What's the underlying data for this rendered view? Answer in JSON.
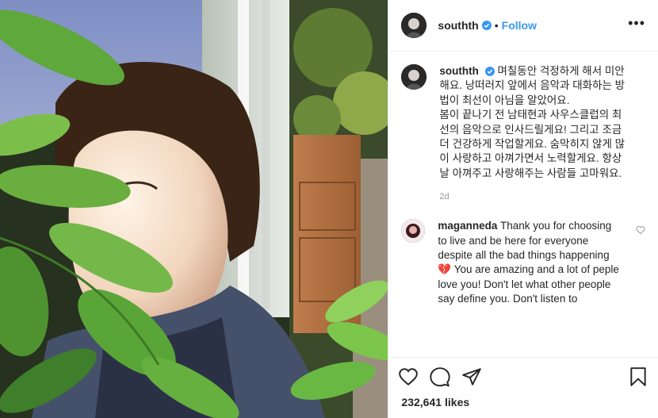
{
  "post": {
    "author": "southth",
    "follow_label": "Follow",
    "separator": "•",
    "caption_user": "southth",
    "caption": "며칠동안 걱정하게 해서 미안해요. 낭떠러지 앞에서 음악과 대화하는 방법이 최선이 아님을 알았어요.\n봄이 끝나기 전 남태현과 사우스클럽의 최선의 음악으로 인사드릴게요! 그리고 조금 더 건강하게 작업할게요. 숨막히지 않게 많이 사랑하고 아껴가면서 노력할게요. 항상 날 아껴주고 사랑해주는 사람들 고마워요.",
    "time_ago": "2d",
    "likes_count": "232,641",
    "likes_label": "likes"
  },
  "comment": {
    "user": "maganneda",
    "text": "Thank you for choosing to live and be here for everyone despite all the bad things happening 💔 You are amazing and a lot of peple love you! Don't let what other people say define you. Don't listen to"
  },
  "icons": {
    "verified": "verified-badge-icon",
    "more": "more-options-icon",
    "like": "heart-icon",
    "comment": "comment-icon",
    "share": "share-icon",
    "save": "bookmark-icon",
    "comment_like": "heart-small-icon"
  },
  "colors": {
    "accent": "#3897f0",
    "text": "#262626",
    "muted": "#999999",
    "border": "#efefef"
  }
}
